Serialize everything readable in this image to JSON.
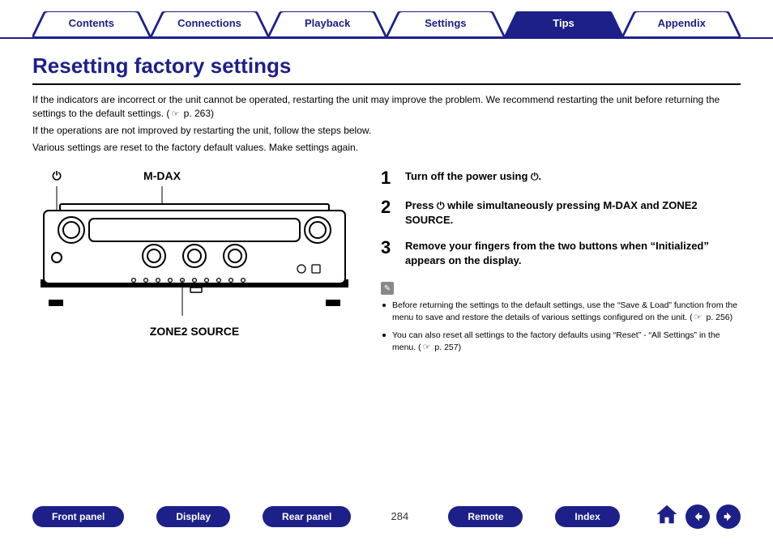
{
  "tabs": {
    "contents": "Contents",
    "connections": "Connections",
    "playback": "Playback",
    "settings": "Settings",
    "tips": "Tips",
    "appendix": "Appendix",
    "active": "tips"
  },
  "title": "Resetting factory settings",
  "intro": {
    "p1a": "If the indicators are incorrect or the unit cannot be operated, restarting the unit may improve the problem. We recommend restarting the unit before returning the settings to the default settings. (",
    "p1_ref": "p. 263",
    "p1b": ")",
    "p2": "If the operations are not improved by restarting the unit, follow the steps below.",
    "p3": "Various settings are reset to the factory default values. Make settings again."
  },
  "diagram": {
    "power_label_icon": "⏻",
    "mdax_label": "M-DAX",
    "zone2_label": "ZONE2 SOURCE"
  },
  "steps": [
    {
      "num": "1",
      "text_a": "Turn off the power using ",
      "text_b": "."
    },
    {
      "num": "2",
      "text_a": "Press ",
      "text_b": " while simultaneously pressing M-DAX and ZONE2 SOURCE."
    },
    {
      "num": "3",
      "text_a": "Remove your fingers from the two buttons when “Initialized” appears on the display.",
      "text_b": ""
    }
  ],
  "notes": [
    {
      "text_a": "Before returning the settings to the default settings, use the “Save & Load” function from the menu to save and restore the details of various settings configured on the unit. (",
      "ref": "p. 256",
      "text_b": ")"
    },
    {
      "text_a": "You can also reset all settings to the factory defaults using “Reset” - “All Settings” in the menu. (",
      "ref": "p. 257",
      "text_b": ")"
    }
  ],
  "bottom": {
    "front_panel": "Front panel",
    "display": "Display",
    "rear_panel": "Rear panel",
    "remote": "Remote",
    "index": "Index",
    "page": "284"
  }
}
